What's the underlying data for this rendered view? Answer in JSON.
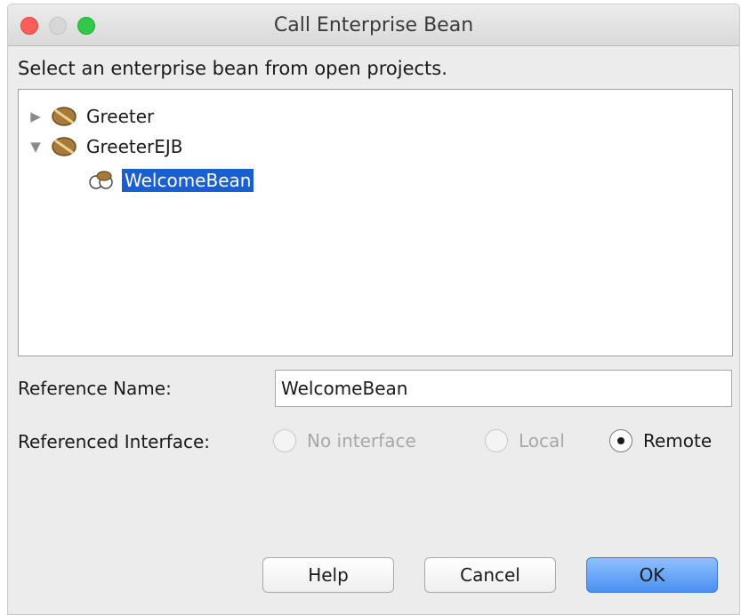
{
  "window": {
    "title": "Call Enterprise Bean"
  },
  "prompt": "Select an enterprise bean from open projects.",
  "tree": {
    "nodes": [
      {
        "label": "Greeter",
        "expanded": false,
        "icon": "bean-project-icon"
      },
      {
        "label": "GreeterEJB",
        "expanded": true,
        "icon": "bean-project-icon"
      },
      {
        "label": "WelcomeBean",
        "selected": true,
        "icon": "session-bean-icon"
      }
    ]
  },
  "reference_name": {
    "label": "Reference Name:",
    "value": "WelcomeBean"
  },
  "referenced_interface": {
    "label": "Referenced Interface:",
    "options": [
      {
        "label": "No interface",
        "enabled": false,
        "checked": false
      },
      {
        "label": "Local",
        "enabled": false,
        "checked": false
      },
      {
        "label": "Remote",
        "enabled": true,
        "checked": true
      }
    ]
  },
  "buttons": {
    "help": "Help",
    "cancel": "Cancel",
    "ok": "OK"
  },
  "colors": {
    "selection": "#1a5fd0",
    "primary_button": "#4a90f0",
    "close": "#fc5f57",
    "maximize": "#34c84a"
  }
}
